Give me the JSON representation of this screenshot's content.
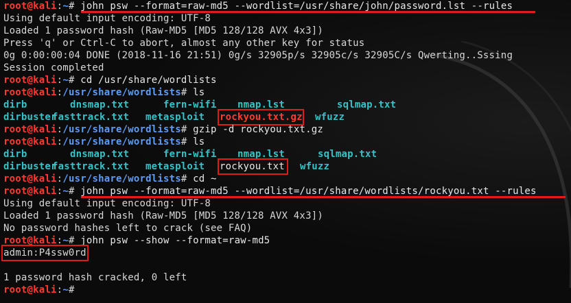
{
  "prompt": {
    "user": "root@kali",
    "sep": ":",
    "home": "~",
    "wordlists": "/usr/share/wordlists",
    "symbol": "# "
  },
  "lines": {
    "cmd1": "john psw --format=raw-md5 --wordlist=/usr/share/john/password.lst --rules",
    "out1_1": "Using default input encoding: UTF-8",
    "out1_2": "Loaded 1 password hash (Raw-MD5 [MD5 128/128 AVX 4x3])",
    "out1_3": "Press 'q' or Ctrl-C to abort, almost any other key for status",
    "out1_4": "0g 0:00:00:04 DONE (2018-11-16 21:51) 0g/s 32905p/s 32905c/s 32905C/s Qwerting..Sssing",
    "out1_5": "Session completed",
    "cmd2": "cd /usr/share/wordlists",
    "cmd3": "ls",
    "cmd4": "gzip -d rockyou.txt.gz",
    "cmd5": "ls",
    "cmd6": "cd ~",
    "cmd7": "john psw --format=raw-md5 --wordlist=/usr/share/wordlists/rockyou.txt --rules",
    "out7_1": "Using default input encoding: UTF-8",
    "out7_2": "Loaded 1 password hash (Raw-MD5 [MD5 128/128 AVX 4x3])",
    "out7_3": "No password hashes left to crack (see FAQ)",
    "cmd8": "john psw --show --format=raw-md5",
    "cracked": "admin:P4ssw0rd",
    "summary": "1 password hash cracked, 0 left",
    "cmd9": ""
  },
  "listing1": {
    "row1": [
      "dirb",
      "dnsmap.txt",
      "fern-wifi",
      "nmap.lst",
      "sqlmap.txt"
    ],
    "row2": [
      "dirbuster",
      "fasttrack.txt",
      "metasploit",
      "rockyou.txt.gz",
      "wfuzz"
    ]
  },
  "listing2": {
    "row1": [
      "dirb",
      "dnsmap.txt",
      "fern-wifi",
      "nmap.lst",
      "sqlmap.txt"
    ],
    "row2": [
      "dirbuster",
      "fasttrack.txt",
      "metasploit",
      "rockyou.txt",
      "wfuzz"
    ]
  },
  "colors": {
    "background": "#0b0b0b",
    "prompt_user": "#ff3b30",
    "prompt_path": "#5c9cf5",
    "directory": "#34c3c8",
    "archive": "#ff3b30",
    "text": "#d8d8d8",
    "highlight": "#e01b1b"
  }
}
